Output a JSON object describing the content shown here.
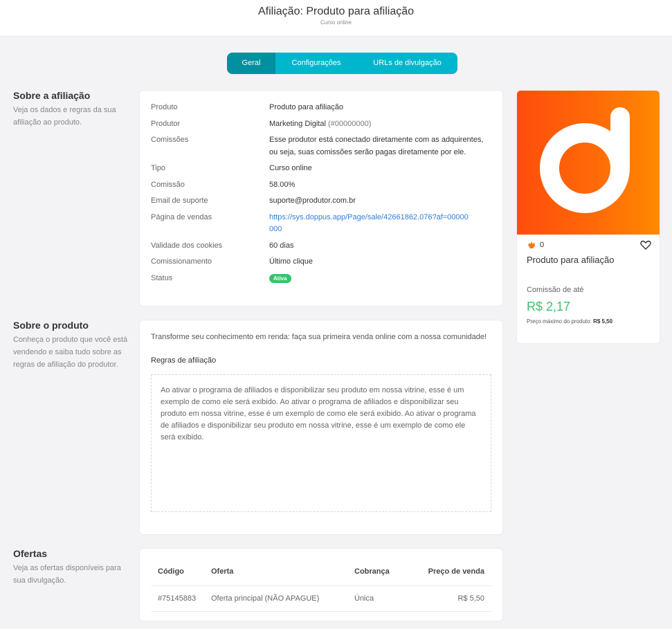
{
  "header": {
    "title": "Afiliação: Produto para afiliação",
    "subtitle": "Curso online"
  },
  "tabs": [
    {
      "label": "Geral",
      "active": true
    },
    {
      "label": "Configurações",
      "active": false
    },
    {
      "label": "URLs de divulgação",
      "active": false
    }
  ],
  "sections": {
    "affiliation": {
      "title": "Sobre a afiliação",
      "description": "Veja os dados e regras da sua afiliação ao produto."
    },
    "product": {
      "title": "Sobre o produto",
      "description": "Conheça o produto que você está vendendo e saiba tudo sobre as regras de afiliação do produtor."
    },
    "offers": {
      "title": "Ofertas",
      "description": "Veja as ofertas disponíveis para sua divulgação."
    }
  },
  "info": {
    "produto_label": "Produto",
    "produto_value": "Produto para afiliação",
    "produtor_label": "Produtor",
    "produtor_name": "Marketing Digital",
    "produtor_id": "(#00000000)",
    "comissoes_label": "Comissões",
    "comissoes_value": "Esse produtor está conectado diretamente com as adquirentes, ou seja, suas comissões serão pagas diretamente por ele.",
    "tipo_label": "Tipo",
    "tipo_value": "Curso online",
    "comissao_label": "Comissão",
    "comissao_value": "58.00%",
    "email_label": "Email de suporte",
    "email_value": "suporte@produtor.com.br",
    "pagina_label": "Página de vendas",
    "pagina_value": "https://sys.doppus.app/Page/sale/42661862.076?af=00000000",
    "validade_label": "Validade dos cookies",
    "validade_value": "60 dias",
    "comissionamento_label": "Comissionamento",
    "comissionamento_value": "Último clique",
    "status_label": "Status",
    "status_value": "Ativa"
  },
  "product": {
    "description": "Transforme seu conhecimento em renda: faça sua primeira venda online com a nossa comunidade!",
    "rules_title": "Regras de afiliação",
    "rules_text": "Ao ativar o programa de afiliados e disponibilizar seu produto em nossa vitrine, esse é um exemplo de como ele será exibido. Ao ativar o programa de afiliados e disponibilizar seu produto em nossa vitrine, esse é um exemplo de como ele será exibido. Ao ativar o programa de afiliados e disponibilizar seu produto em nossa vitrine, esse é um exemplo de como ele será exibido."
  },
  "offers": {
    "headers": {
      "codigo": "Código",
      "oferta": "Oferta",
      "cobranca": "Cobrança",
      "preco": "Preço de venda"
    },
    "rows": [
      {
        "codigo": "#75145883",
        "oferta": "Oferta principal (NÃO APAGUE)",
        "cobranca": "Única",
        "preco": "R$ 5,50"
      }
    ]
  },
  "side_card": {
    "brand_color": "#ff6a08",
    "likes_count": "0",
    "product_name": "Produto para afiliação",
    "commission_label": "Comissão de até",
    "commission_amount": "R$ 2,17",
    "max_price_label": "Preço máximo do produto:",
    "max_price_value": "R$ 5,50"
  }
}
